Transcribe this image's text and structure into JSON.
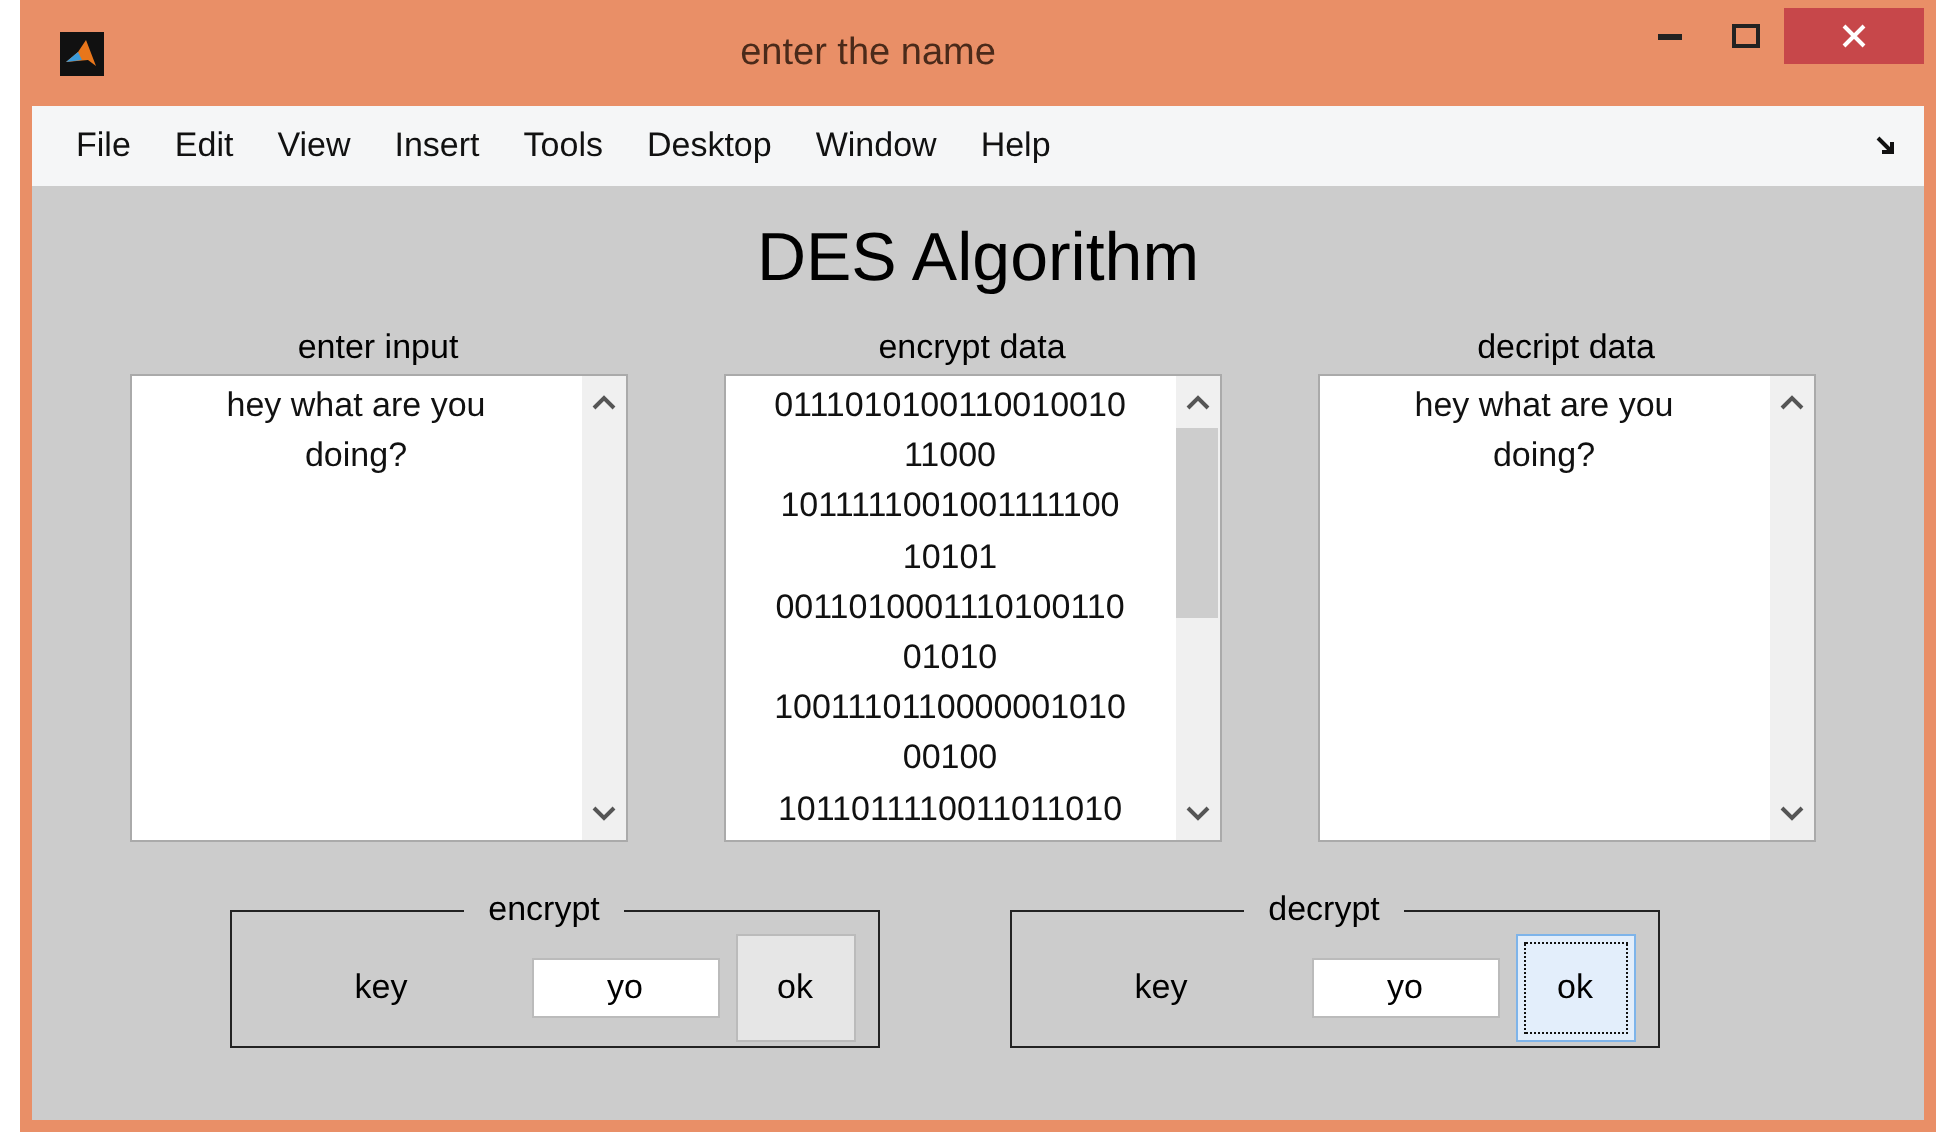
{
  "window": {
    "title": "enter the name"
  },
  "menu": [
    "File",
    "Edit",
    "View",
    "Insert",
    "Tools",
    "Desktop",
    "Window",
    "Help"
  ],
  "heading": "DES Algorithm",
  "panes": [
    {
      "label": "enter input",
      "lines": [
        "hey what are you",
        "doing?"
      ],
      "scroll_thumb": false
    },
    {
      "label": "encrypt data",
      "lines": [
        "0111010100110010010",
        "11000",
        "1011111001001111100",
        "10101",
        "0011010001110100110",
        "01010",
        "1001110110000001010",
        "00100",
        "1011011110011011010"
      ],
      "scroll_thumb": true
    },
    {
      "label": "decript data",
      "lines": [
        "hey what are you",
        "doing?"
      ],
      "scroll_thumb": false
    }
  ],
  "groups": [
    {
      "title": "encrypt",
      "key_label": "key",
      "key_value": "yo",
      "button": "ok",
      "focused": false
    },
    {
      "title": "decrypt",
      "key_label": "key",
      "key_value": "yo",
      "button": "ok",
      "focused": true
    }
  ]
}
